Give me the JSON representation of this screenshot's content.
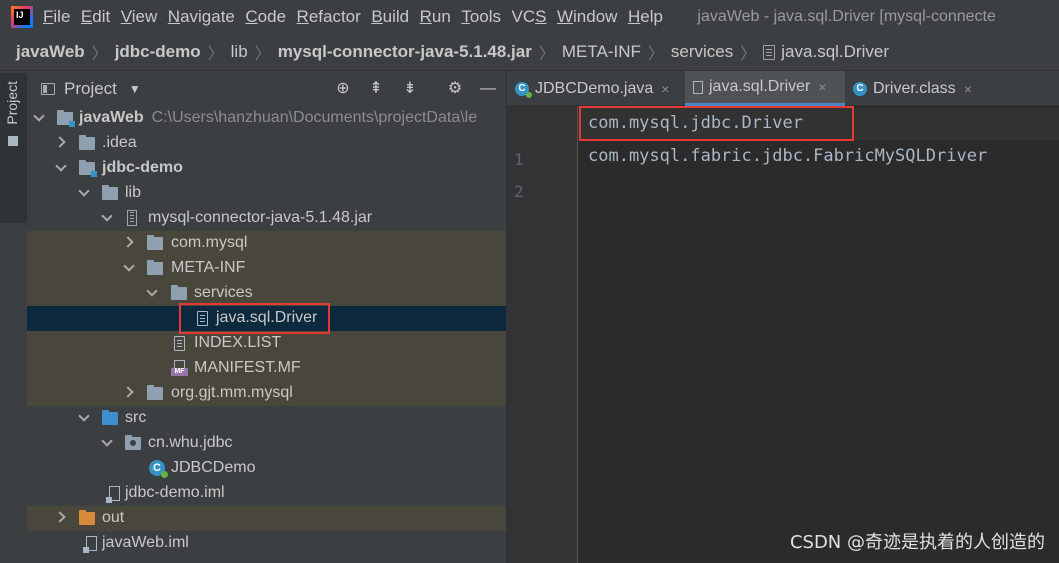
{
  "app": {
    "logo_text": "IJ",
    "menu": [
      {
        "label": "File",
        "mnemonic": "F",
        "rest": "ile"
      },
      {
        "label": "Edit",
        "mnemonic": "E",
        "rest": "dit"
      },
      {
        "label": "View",
        "mnemonic": "V",
        "rest": "iew"
      },
      {
        "label": "Navigate",
        "mnemonic": "N",
        "rest": "avigate"
      },
      {
        "label": "Code",
        "mnemonic": "C",
        "rest": "ode"
      },
      {
        "label": "Refactor",
        "mnemonic": "R",
        "rest": "efactor"
      },
      {
        "label": "Build",
        "mnemonic": "B",
        "rest": "uild"
      },
      {
        "label": "Run",
        "mnemonic": "R",
        "rest": "un"
      },
      {
        "label": "Tools",
        "mnemonic": "T",
        "rest": "ools"
      },
      {
        "label": "VCS",
        "mnemonic": "S",
        "rest": ""
      },
      {
        "label": "Window",
        "mnemonic": "W",
        "rest": "indow"
      },
      {
        "label": "Help",
        "mnemonic": "H",
        "rest": "elp"
      }
    ],
    "window_title": "javaWeb - java.sql.Driver [mysql-connecte"
  },
  "breadcrumb": [
    "javaWeb",
    "jdbc-demo",
    "lib",
    "mysql-connector-java-5.1.48.jar",
    "META-INF",
    "services",
    "java.sql.Driver"
  ],
  "left_strip": {
    "tab_label": "Project"
  },
  "project_panel": {
    "title": "Project",
    "tools": {
      "locate": "⊕",
      "expand": "⇞",
      "collapse": "⇟",
      "settings": "⚙",
      "hide": "—"
    },
    "tree": [
      {
        "label": "javaWeb",
        "extra": "C:\\Users\\hanzhuan\\Documents\\projectData\\le",
        "icon": "module-folder"
      },
      {
        "label": ".idea",
        "icon": "folder"
      },
      {
        "label": "jdbc-demo",
        "icon": "module-folder"
      },
      {
        "label": "lib",
        "icon": "folder"
      },
      {
        "label": "mysql-connector-java-5.1.48.jar",
        "icon": "jar"
      },
      {
        "label": "com.mysql",
        "icon": "folder"
      },
      {
        "label": "META-INF",
        "icon": "folder"
      },
      {
        "label": "services",
        "icon": "folder"
      },
      {
        "label": "java.sql.Driver",
        "icon": "text-file"
      },
      {
        "label": "INDEX.LIST",
        "icon": "text-file"
      },
      {
        "label": "MANIFEST.MF",
        "icon": "manifest-file",
        "badge": "MF"
      },
      {
        "label": "org.gjt.mm.mysql",
        "icon": "folder"
      },
      {
        "label": "src",
        "icon": "source-folder"
      },
      {
        "label": "cn.whu.jdbc",
        "icon": "package"
      },
      {
        "label": "JDBCDemo",
        "icon": "class",
        "glyph": "C"
      },
      {
        "label": "jdbc-demo.iml",
        "icon": "iml-file"
      },
      {
        "label": "out",
        "icon": "excluded-folder"
      },
      {
        "label": "javaWeb.iml",
        "icon": "iml-file"
      }
    ]
  },
  "editor": {
    "tabs": [
      {
        "label": "JDBCDemo.java",
        "icon": "class",
        "glyph": "C",
        "close": "×"
      },
      {
        "label": "java.sql.Driver",
        "icon": "text-file",
        "close": "×"
      },
      {
        "label": "Driver.class",
        "icon": "class",
        "glyph": "C",
        "close": "×"
      }
    ],
    "lines": [
      {
        "number": "1",
        "text": "com.mysql.jdbc.Driver"
      },
      {
        "number": "2",
        "text": "com.mysql.fabric.jdbc.FabricMySQLDriver"
      }
    ]
  },
  "watermark": "CSDN @奇迹是执着的人创造的",
  "colors": {
    "highlight_box": "#e53935",
    "selection": "#0d293e",
    "jar_contents_bg": "#49473b",
    "active_tab_underline": "#4a88c7"
  }
}
